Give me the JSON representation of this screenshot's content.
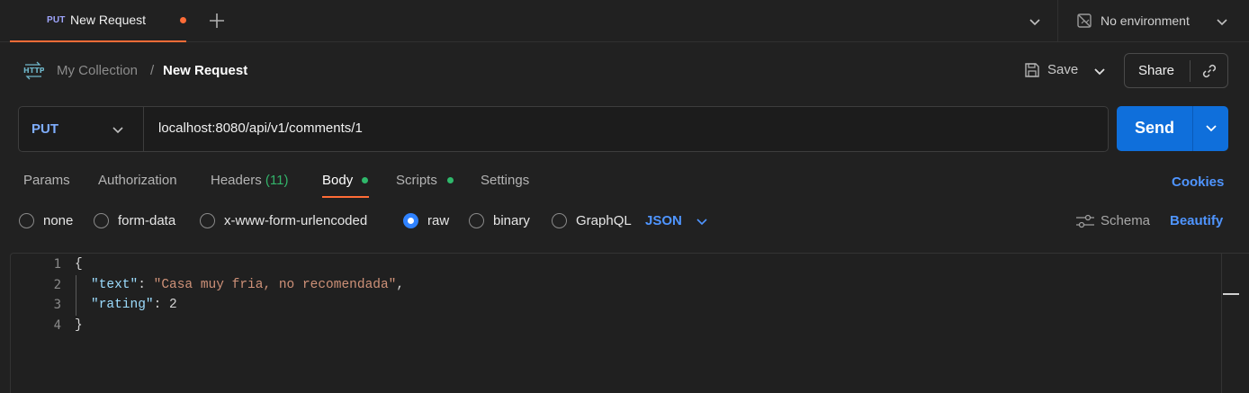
{
  "tabbar": {
    "tab_method": "PUT",
    "tab_name": "New Request",
    "environment": "No environment"
  },
  "breadcrumb": {
    "collection": "My Collection",
    "separator": "/",
    "current": "New Request"
  },
  "actions": {
    "save_label": "Save",
    "share_label": "Share"
  },
  "request": {
    "method": "PUT",
    "url": "localhost:8080/api/v1/comments/1",
    "send_label": "Send"
  },
  "request_tabs": {
    "params": "Params",
    "authorization": "Authorization",
    "headers": "Headers",
    "headers_count": "(11)",
    "body": "Body",
    "scripts": "Scripts",
    "settings": "Settings",
    "cookies": "Cookies"
  },
  "body_types": {
    "none": "none",
    "form_data": "form-data",
    "urlencoded": "x-www-form-urlencoded",
    "raw": "raw",
    "binary": "binary",
    "graphql": "GraphQL",
    "selected": "raw",
    "format": "JSON",
    "schema": "Schema",
    "beautify": "Beautify"
  },
  "editor": {
    "line_numbers": [
      "1",
      "2",
      "3",
      "4"
    ],
    "open_brace": "{",
    "close_brace": "}",
    "key_text": "\"text\"",
    "value_text": "\"Casa muy fria, no recomendada\"",
    "key_rating": "\"rating\"",
    "value_rating": "2"
  },
  "colors": {
    "accent_orange": "#ff6c37",
    "send_blue": "#0f6fdb",
    "link_blue": "#4f95ff",
    "status_green": "#2fb86b",
    "background": "#212121"
  },
  "icons": [
    "plus-icon",
    "chevron-down-icon",
    "no-environment-icon",
    "http-icon",
    "save-icon",
    "link-icon",
    "schema-icon"
  ]
}
